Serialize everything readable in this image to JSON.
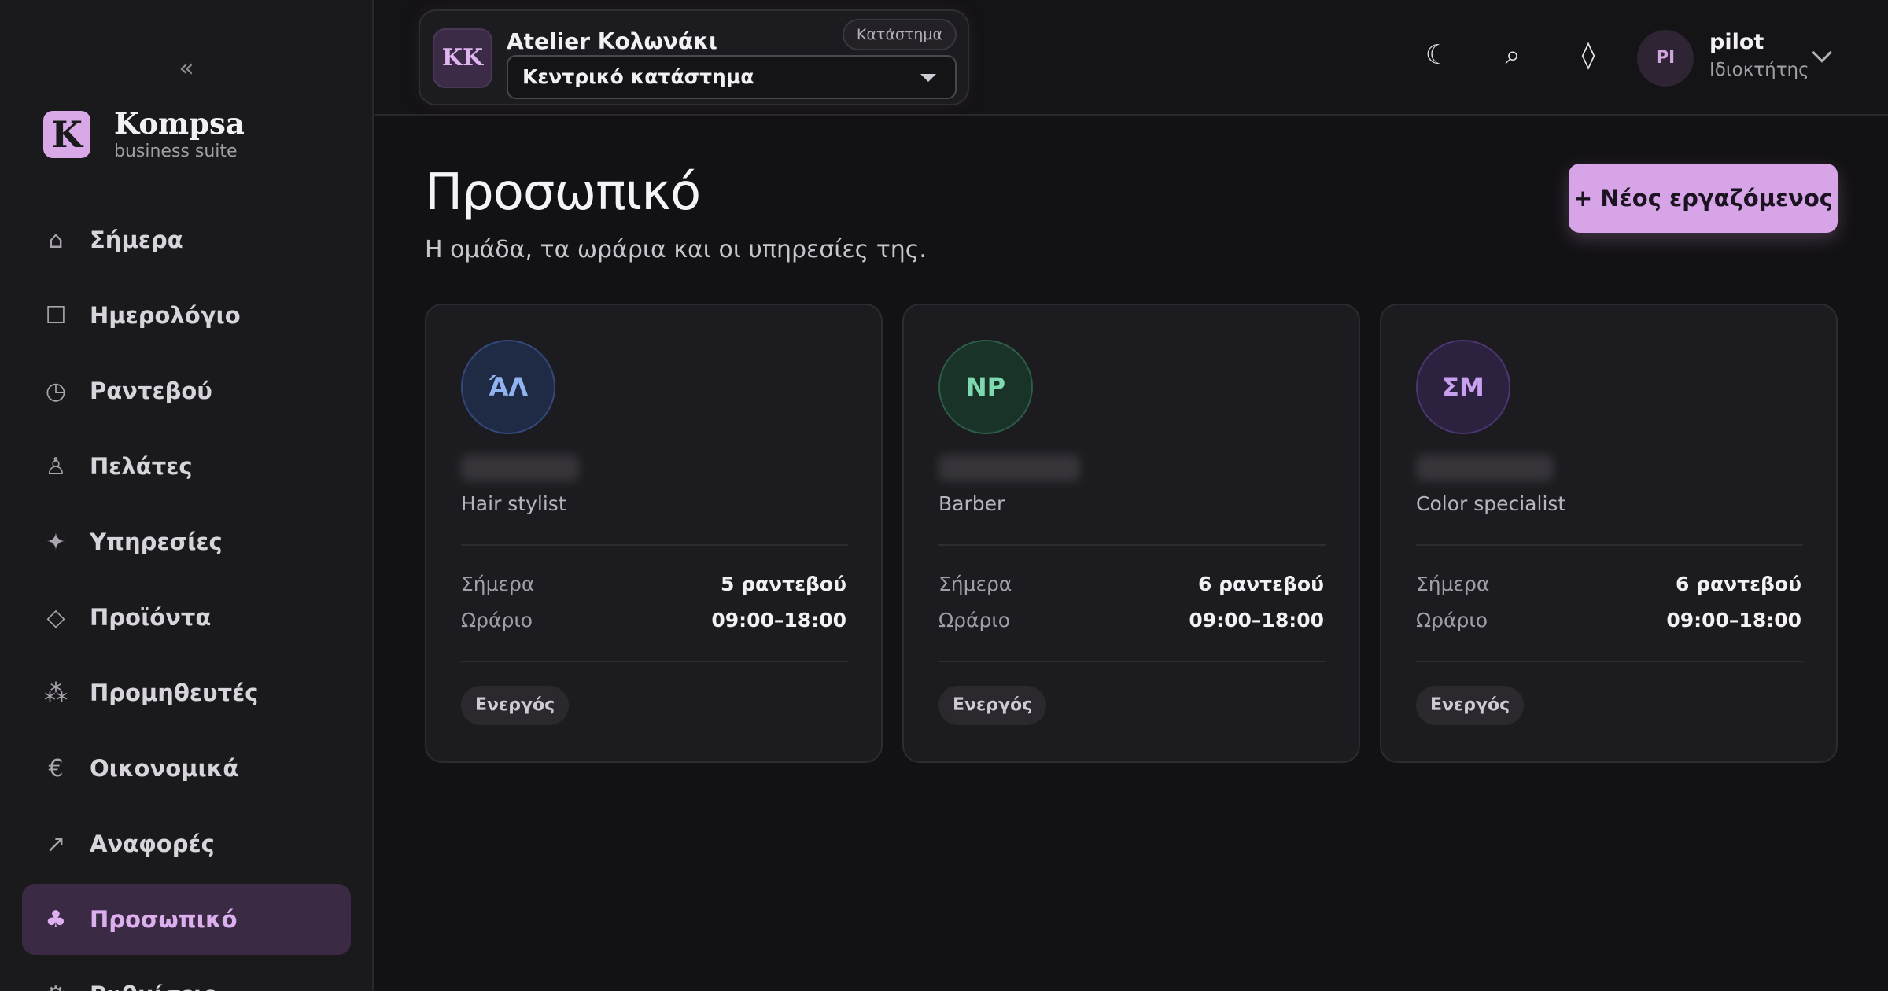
{
  "sidebar": {
    "collapse_label": "«",
    "brand": {
      "logo_letter": "K",
      "name": "Kompsa",
      "subtitle": "business suite"
    },
    "items": [
      {
        "label": "Σήμερα",
        "icon": "home-icon",
        "glyph": "⌂"
      },
      {
        "label": "Ημερολόγιο",
        "icon": "calendar-icon",
        "glyph": "☐"
      },
      {
        "label": "Ραντεβού",
        "icon": "clock-icon",
        "glyph": "◷"
      },
      {
        "label": "Πελάτες",
        "icon": "person-icon",
        "glyph": "♙"
      },
      {
        "label": "Υπηρεσίες",
        "icon": "sparkle-icon",
        "glyph": "✦"
      },
      {
        "label": "Προϊόντα",
        "icon": "diamond-icon",
        "glyph": "◇"
      },
      {
        "label": "Προμηθευτές",
        "icon": "nodes-icon",
        "glyph": "⁂"
      },
      {
        "label": "Οικονομικά",
        "icon": "euro-icon",
        "glyph": "€"
      },
      {
        "label": "Αναφορές",
        "icon": "arrow-up-right-icon",
        "glyph": "↗"
      },
      {
        "label": "Προσωπικό",
        "icon": "staff-icon",
        "glyph": "♣",
        "active": true
      },
      {
        "label": "Ρυθμίσεις",
        "icon": "settings-icon",
        "glyph": "⚙"
      }
    ]
  },
  "topbar": {
    "store": {
      "initials": "KK",
      "name": "Atelier Κολωνάκι",
      "tag": "Κατάστημα",
      "selected": "Κεντρικό κατάστημα"
    },
    "icons": {
      "theme": "☾",
      "search": "⌕",
      "diamond": "◊"
    },
    "user": {
      "initials": "PI",
      "name": "pilot",
      "role": "Ιδιοκτήτης"
    }
  },
  "main": {
    "title": "Προσωπικό",
    "subtitle": "Η ομάδα, τα ωράρια και οι υπηρεσίες της.",
    "new_button": "+ Νέος εργαζόμενος"
  },
  "colors": {
    "accent": "#d7a4e8",
    "avatar_blue": "#8fb4f0",
    "avatar_green": "#7fd9b0",
    "avatar_purple": "#c9a0f0"
  },
  "staff": [
    {
      "initials": "ΆΛ",
      "role": "Hair stylist",
      "today_label": "Σήμερα",
      "today_value": "5 ραντεβού",
      "hours_label": "Ωράριο",
      "hours_value": "09:00–18:00",
      "status": "Ενεργός"
    },
    {
      "initials": "NP",
      "role": "Barber",
      "today_label": "Σήμερα",
      "today_value": "6 ραντεβού",
      "hours_label": "Ωράριο",
      "hours_value": "09:00–18:00",
      "status": "Ενεργός"
    },
    {
      "initials": "ΣΜ",
      "role": "Color specialist",
      "today_label": "Σήμερα",
      "today_value": "6 ραντεβού",
      "hours_label": "Ωράριο",
      "hours_value": "09:00–18:00",
      "status": "Ενεργός"
    }
  ]
}
